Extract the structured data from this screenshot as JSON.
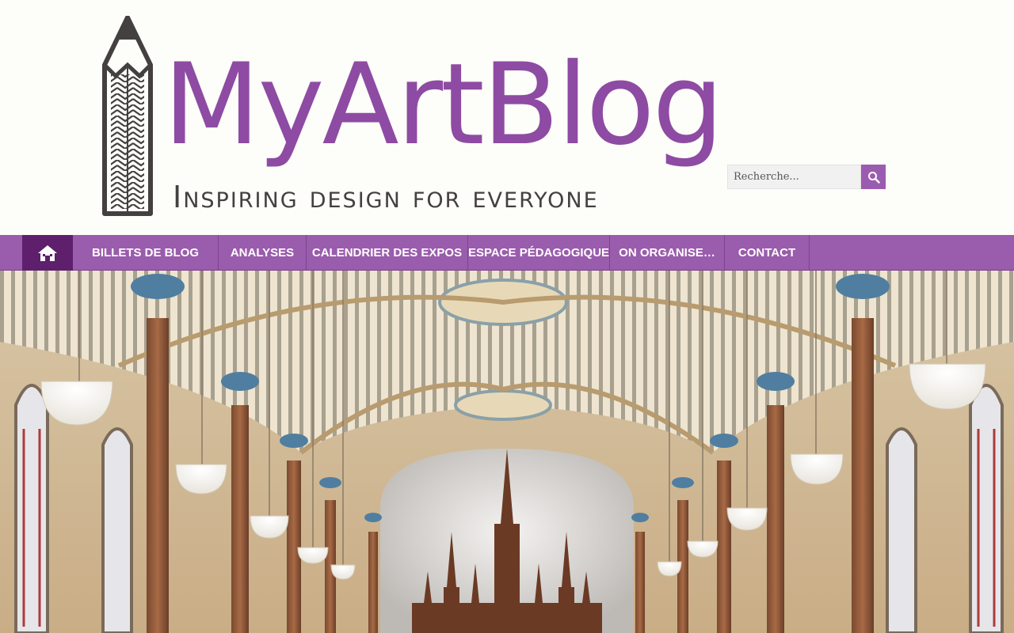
{
  "header": {
    "logo_title": "MyArtBlog",
    "tagline": "Inspiring design for everyone"
  },
  "search": {
    "placeholder": "Recherche...",
    "button_icon": "search-icon"
  },
  "nav": {
    "home_icon": "home-icon",
    "items": [
      {
        "label": "BILLETS DE BLOG"
      },
      {
        "label": "ANALYSES"
      },
      {
        "label": "CALENDRIER DES EXPOS"
      },
      {
        "label": "ESPACE PÉDAGOGIQUE"
      },
      {
        "label": "ON ORGANISE…"
      },
      {
        "label": "CONTACT"
      }
    ]
  },
  "colors": {
    "brand_purple": "#8e4ba3",
    "nav_bg": "#9a5cac",
    "nav_home_bg": "#5e1f6c",
    "text_dark": "#444040",
    "page_bg": "#fdfdf9"
  }
}
